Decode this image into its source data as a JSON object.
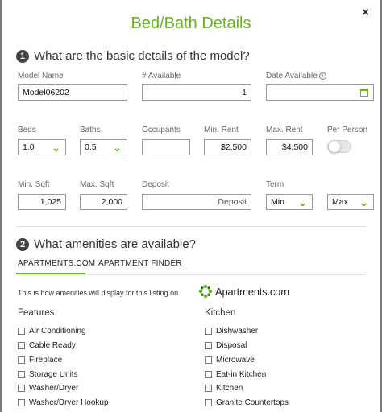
{
  "modal": {
    "title": "Bed/Bath Details",
    "close": "×"
  },
  "section1": {
    "number": "1",
    "heading": "What are the basic details of the model?"
  },
  "fields": {
    "model_name": {
      "label": "Model Name",
      "value": "Model06202"
    },
    "available": {
      "label": "# Available",
      "value": "1"
    },
    "date_available": {
      "label": "Date Available",
      "value": ""
    },
    "beds": {
      "label": "Beds",
      "value": "1.0"
    },
    "baths": {
      "label": "Baths",
      "value": "0.5"
    },
    "occupants": {
      "label": "Occupants",
      "value": ""
    },
    "min_rent": {
      "label": "Min. Rent",
      "value": "$2,500"
    },
    "max_rent": {
      "label": "Max. Rent",
      "value": "$4,500"
    },
    "per_person": {
      "label": "Per Person",
      "on": false
    },
    "min_sqft": {
      "label": "Min. Sqft",
      "value": "1,025"
    },
    "max_sqft": {
      "label": "Max. Sqft",
      "value": "2,000"
    },
    "deposit": {
      "label": "Deposit",
      "placeholder": "Deposit"
    },
    "term": {
      "label": "Term",
      "min": "Min",
      "max": "Max"
    }
  },
  "section2": {
    "number": "2",
    "heading": "What amenities are available?"
  },
  "tabs": [
    "APARTMENTS.COM",
    "APARTMENT FINDER"
  ],
  "note": "This is how amenities will display for this listing on",
  "logo_text": "Apartments.com",
  "features": {
    "heading": "Features",
    "items": [
      "Air Conditioning",
      "Cable Ready",
      "Fireplace",
      "Storage Units",
      "Washer/Dryer",
      "Washer/Dryer Hookup"
    ]
  },
  "kitchen": {
    "heading": "Kitchen",
    "items": [
      "Dishwasher",
      "Disposal",
      "Microwave",
      "Eat-in Kitchen",
      "Kitchen",
      "Granite Countertops"
    ]
  },
  "colors": {
    "accent": "#6ab023",
    "backdrop": "#7c7c7c"
  }
}
